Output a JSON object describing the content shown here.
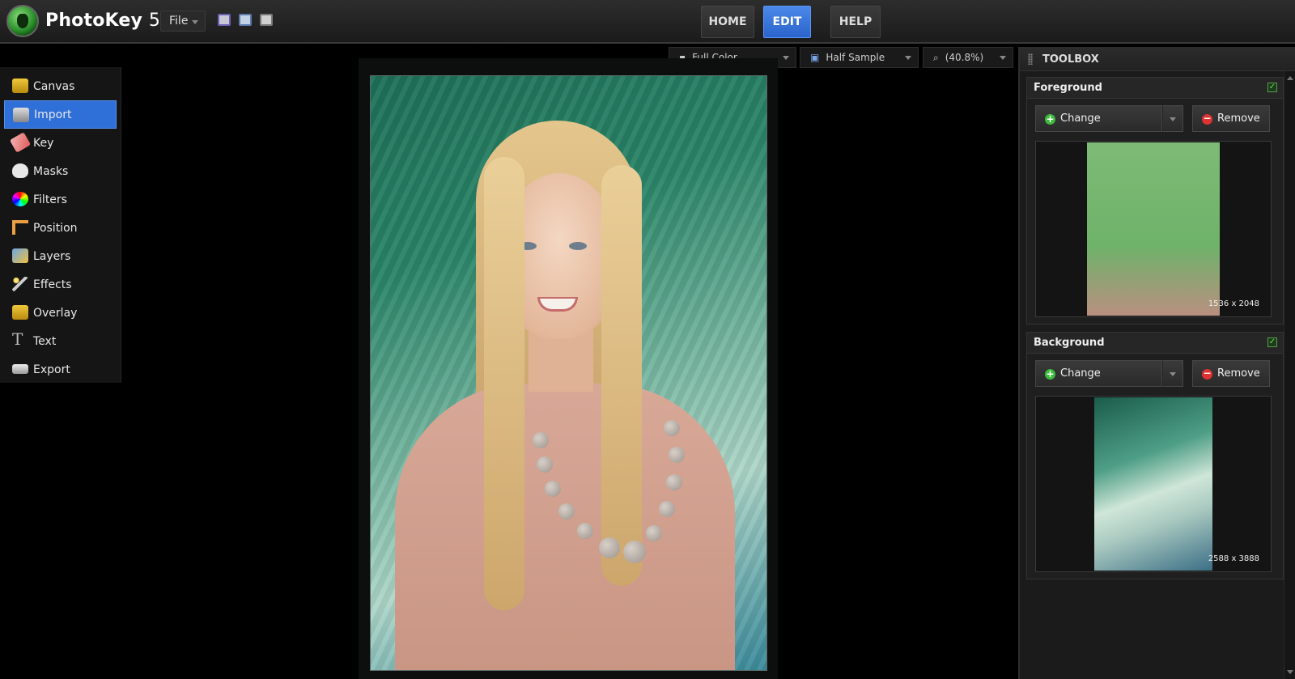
{
  "app": {
    "name": "PhotoKey",
    "version": "5"
  },
  "toolbar": {
    "file_label": "File",
    "icons": [
      "save-icon",
      "open-icon",
      "print-icon"
    ]
  },
  "nav": {
    "home": "HOME",
    "edit": "EDIT",
    "help": "HELP",
    "active": "EDIT"
  },
  "sidebar": {
    "items": [
      {
        "label": "Canvas",
        "icon": "canvas-icon"
      },
      {
        "label": "Import",
        "icon": "camera-icon"
      },
      {
        "label": "Key",
        "icon": "eraser-icon"
      },
      {
        "label": "Masks",
        "icon": "mask-icon"
      },
      {
        "label": "Filters",
        "icon": "color-wheel-icon"
      },
      {
        "label": "Position",
        "icon": "position-icon"
      },
      {
        "label": "Layers",
        "icon": "layers-icon"
      },
      {
        "label": "Effects",
        "icon": "magic-wand-icon"
      },
      {
        "label": "Overlay",
        "icon": "overlay-icon"
      },
      {
        "label": "Text",
        "icon": "text-icon"
      },
      {
        "label": "Export",
        "icon": "export-icon"
      }
    ],
    "active_index": 1
  },
  "display": {
    "color_mode": "Full Color",
    "sample": "Half Sample",
    "zoom": "(40.8%)"
  },
  "toolbox": {
    "title": "TOOLBOX",
    "foreground": {
      "title": "Foreground",
      "enabled": true,
      "change_label": "Change",
      "remove_label": "Remove",
      "dimensions": "1536 x 2048"
    },
    "background": {
      "title": "Background",
      "enabled": true,
      "change_label": "Change",
      "remove_label": "Remove",
      "dimensions": "2588 x 3888"
    }
  },
  "colors": {
    "accent": "#2f6fd8",
    "panel_bg": "#1b1b1b",
    "checkbox": "#6ddb4a"
  }
}
